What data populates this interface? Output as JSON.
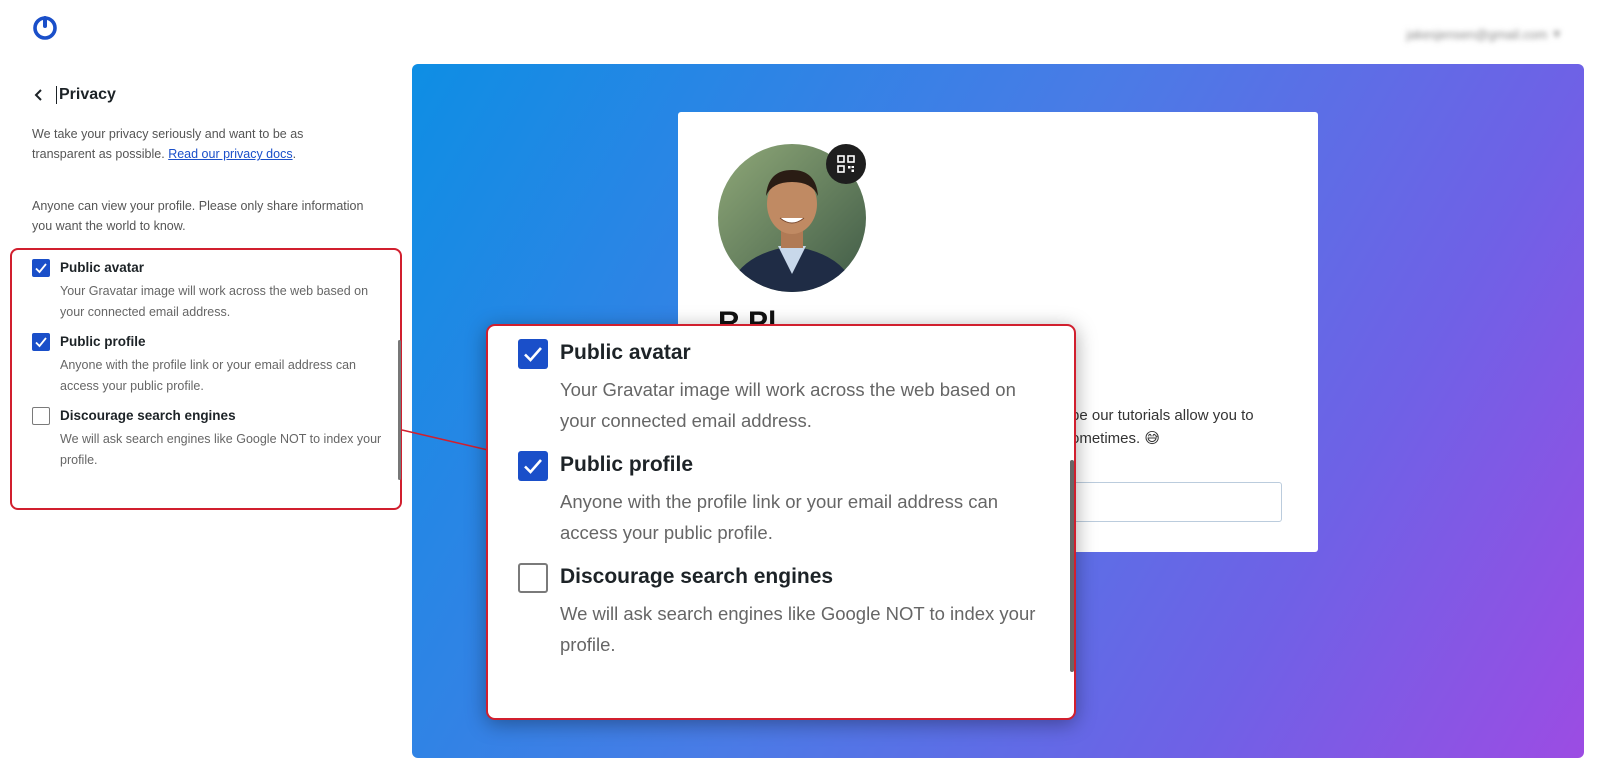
{
  "header": {
    "logo_icon": "gravatar-power-icon",
    "account_email": "jakesjensen@gmail.com"
  },
  "privacy": {
    "title": "Privacy",
    "intro_text": "We take your privacy seriously and want to be as transparent as possible.",
    "privacy_link": "Read our privacy docs",
    "intro_period": ".",
    "notice": "Anyone can view your profile. Please only share information you want the world to know.",
    "options": [
      {
        "label": "Public avatar",
        "description": "Your Gravatar image will work across the web based on your connected email address.",
        "checked": true
      },
      {
        "label": "Public profile",
        "description": "Anyone with the profile link or your email address can access your public profile.",
        "checked": true
      },
      {
        "label": "Discourage search engines",
        "description": "We will ask search engines like Google NOT to index your profile.",
        "checked": false
      }
    ]
  },
  "preview": {
    "name_partial": "R     Pl",
    "text_partial": "pe our tutorials allow you to ometimes. 😅"
  },
  "colors": {
    "accent": "#1a4fc9",
    "highlight": "#d11f2e",
    "gradient_start": "#0e8ee4",
    "gradient_end": "#9c4ce3"
  }
}
